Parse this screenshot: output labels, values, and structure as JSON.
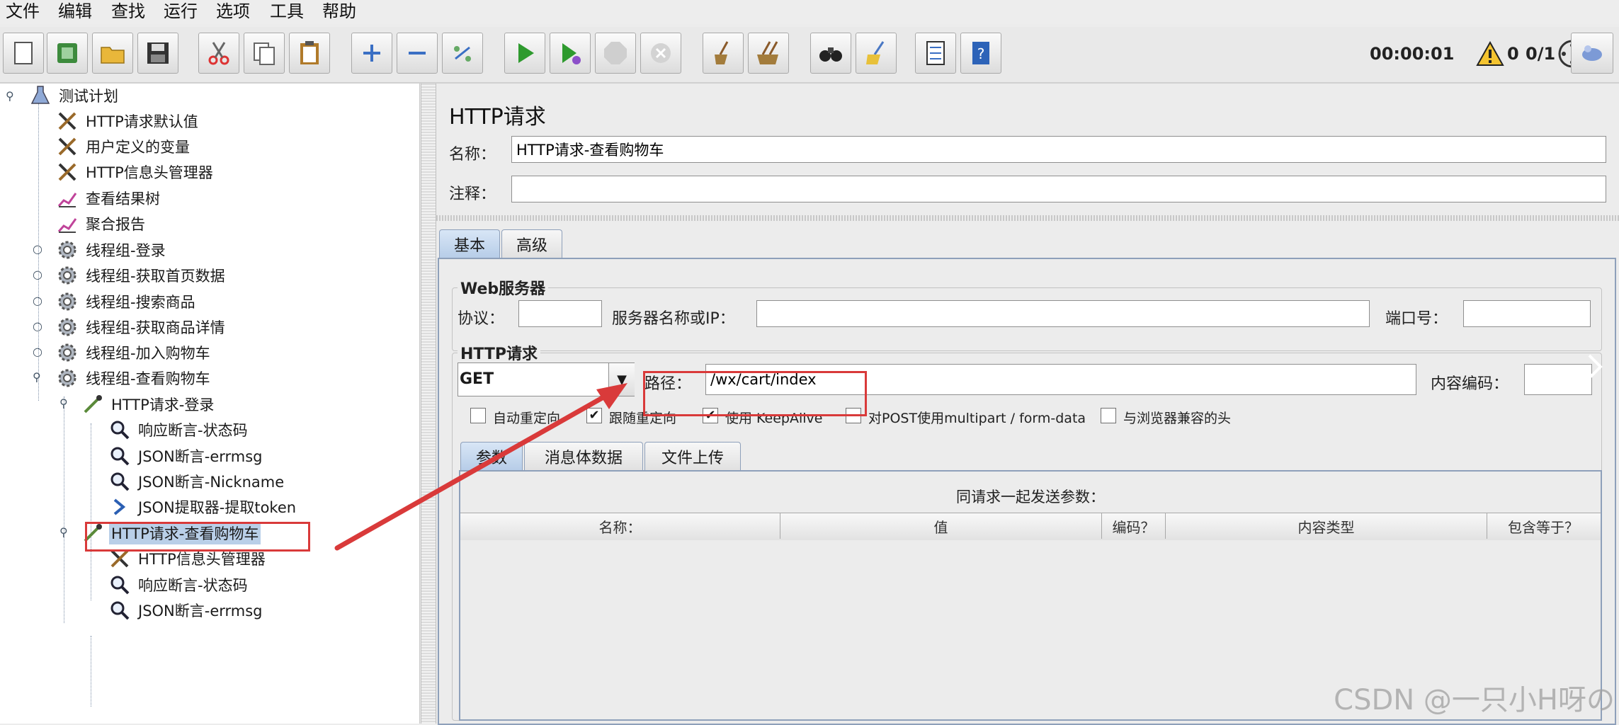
{
  "menubar": {
    "items": [
      "文件",
      "编辑",
      "查找",
      "运行",
      "选项",
      "工具",
      "帮助"
    ]
  },
  "toolbar": {
    "icons": [
      "new-icon",
      "template-icon",
      "open-icon",
      "save-icon",
      "cut-icon",
      "copy-icon",
      "paste-icon",
      "expand-icon",
      "collapse-icon",
      "toggle-icon",
      "start-icon",
      "start-no-pause-icon",
      "stop-icon",
      "shutdown-icon",
      "clear-icon",
      "clear-all-icon",
      "search-icon",
      "reset-search-icon",
      "function-helper-icon",
      "help-icon"
    ],
    "timer": "00:00:01",
    "warning_count": "0",
    "threads": "0/1"
  },
  "tree": {
    "root": "测试计划",
    "nodes": [
      {
        "label": "HTTP请求默认值",
        "icon": "wrench-icon"
      },
      {
        "label": "用户定义的变量",
        "icon": "wrench-icon"
      },
      {
        "label": "HTTP信息头管理器",
        "icon": "wrench-icon"
      },
      {
        "label": "查看结果树",
        "icon": "chart-icon"
      },
      {
        "label": "聚合报告",
        "icon": "chart-icon"
      },
      {
        "label": "线程组-登录",
        "icon": "gear-icon"
      },
      {
        "label": "线程组-获取首页数据",
        "icon": "gear-icon"
      },
      {
        "label": "线程组-搜索商品",
        "icon": "gear-icon"
      },
      {
        "label": "线程组-获取商品详情",
        "icon": "gear-icon"
      },
      {
        "label": "线程组-加入购物车",
        "icon": "gear-icon"
      },
      {
        "label": "线程组-查看购物车",
        "icon": "gear-icon"
      },
      {
        "label": "HTTP请求-登录",
        "icon": "pipette-icon"
      },
      {
        "label": "响应断言-状态码",
        "icon": "magnifier-icon"
      },
      {
        "label": "JSON断言-errmsg",
        "icon": "magnifier-icon"
      },
      {
        "label": "JSON断言-Nickname",
        "icon": "magnifier-icon"
      },
      {
        "label": "JSON提取器-提取token",
        "icon": "extractor-icon"
      },
      {
        "label": "HTTP请求-查看购物车",
        "icon": "pipette-icon"
      },
      {
        "label": "HTTP信息头管理器",
        "icon": "wrench-icon"
      },
      {
        "label": "响应断言-状态码",
        "icon": "magnifier-icon"
      },
      {
        "label": "JSON断言-errmsg",
        "icon": "magnifier-icon"
      }
    ]
  },
  "panel": {
    "title": "HTTP请求",
    "name_label": "名称：",
    "name_value": "HTTP请求-查看购物车",
    "comment_label": "注释：",
    "comment_value": "",
    "tabs": [
      "基本",
      "高级"
    ],
    "web_server": {
      "legend": "Web服务器",
      "protocol_label": "协议：",
      "protocol_value": "",
      "server_label": "服务器名称或IP：",
      "server_value": "",
      "port_label": "端口号：",
      "port_value": ""
    },
    "http_request": {
      "legend": "HTTP请求",
      "method": "GET",
      "path_label": "路径：",
      "path_value": "/wx/cart/index",
      "encoding_label": "内容编码：",
      "encoding_value": ""
    },
    "options": [
      {
        "label": "自动重定向",
        "checked": false
      },
      {
        "label": "跟随重定向",
        "checked": true
      },
      {
        "label": "使用 KeepAlive",
        "checked": true
      },
      {
        "label": "对POST使用multipart / form-data",
        "checked": false
      },
      {
        "label": "与浏览器兼容的头",
        "checked": false
      }
    ],
    "subtabs": [
      "参数",
      "消息体数据",
      "文件上传"
    ],
    "params_caption": "同请求一起发送参数：",
    "columns": [
      "名称：",
      "值",
      "编码？",
      "内容类型",
      "包含等于？"
    ]
  },
  "watermark": "CSDN @一只小H呀の",
  "colors": {
    "annotation": "#d93a3a",
    "selection": "#b9cfe8",
    "tab_active": "#b7cde8"
  }
}
